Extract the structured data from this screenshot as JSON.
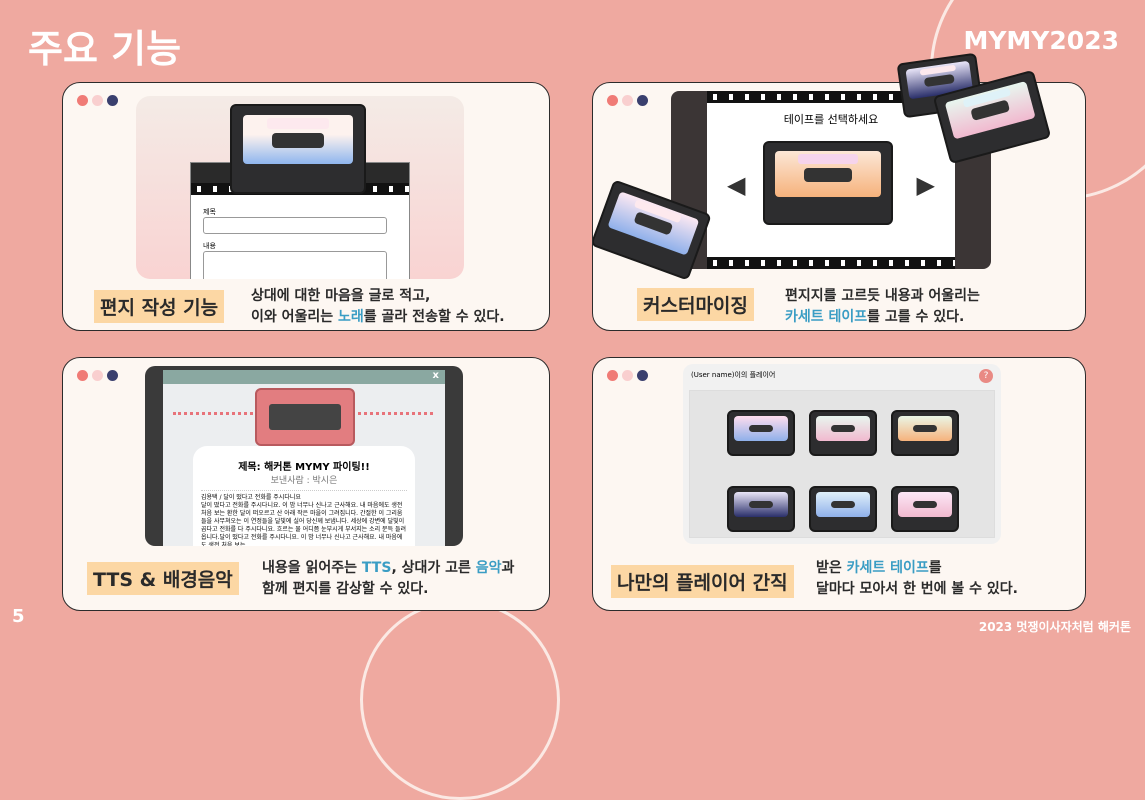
{
  "slide": {
    "title": "주요 기능",
    "brand": "MYMY2023",
    "page_number": "5",
    "footer": "2023 멋쟁이사자처럼 해커톤"
  },
  "colors": {
    "background": "#efa9a0",
    "card": "#fdf7f2",
    "label_bg": "#fcd7a4",
    "highlight": "#3a9dc4",
    "dot1": "#f07b76",
    "dot2": "#f9cfcf",
    "dot3": "#3a3f6e"
  },
  "cards": [
    {
      "label": "편지 작성 기능",
      "desc_line1": "상대에 대한 마음을 글로 적고,",
      "desc_line2_pre": "이와 어울리는 ",
      "desc_line2_hl": "노래",
      "desc_line2_post": "를 골라 전송할 수 있다.",
      "form_title_label": "제목",
      "form_content_label": "내용"
    },
    {
      "label": "커스터마이징",
      "desc_line1": "편지지를 고르듯 내용과 어울리는",
      "desc_line2_pre": "",
      "desc_line2_hl": "카세트 테이프",
      "desc_line2_post": "를 고를 수 있다.",
      "screen_title": "테이프를 선택하세요"
    },
    {
      "label": "TTS & 배경음악",
      "desc_line1_pre": "내용을 읽어주는 ",
      "desc_line1_hl1": "TTS",
      "desc_line1_mid": ", 상대가 고른 ",
      "desc_line1_hl2": "음악",
      "desc_line1_post": "과",
      "desc_line2": "함께 편지를 감상할 수 있다.",
      "letter_title": "제목: 해커톤 MYMY 파이팅!!",
      "letter_sender": "보낸사람 : 박시은",
      "letter_body": "김용택 / 달이 떴다고 전화를 주시다니요\n달이 떴다고 전화를 주시다니요. 이 밤 너무나 신나고 근사해요. 내 마음에도 생전 처음 보는 환한 달이 떠오르고 산 아래 작은 마을이 그려집니다. 간절한 이 그리움들을 사무쳐오는 이 연정들을 달빛에 실어 당신께 보냅니다. 세상에 강변에 달빛이 곱다고 전화를 다 주시다니요. 흐르는 물 어디쯤 눈부시게 부서지는 소리 문득 들려옵니다.달이 떴다고 전화를 주시다니요. 이 밤 너무나 신나고 근사해요. 내 마음에도 생전 처음 보는",
      "close": "x"
    },
    {
      "label": "나만의 플레이어 간직",
      "desc_line1_pre": "받은 ",
      "desc_line1_hl": "카세트 테이프",
      "desc_line1_post": "를",
      "desc_line2": "달마다 모아서 한 번에 볼 수 있다.",
      "player_title": "(User name)이의 플레이어",
      "help": "?"
    }
  ]
}
